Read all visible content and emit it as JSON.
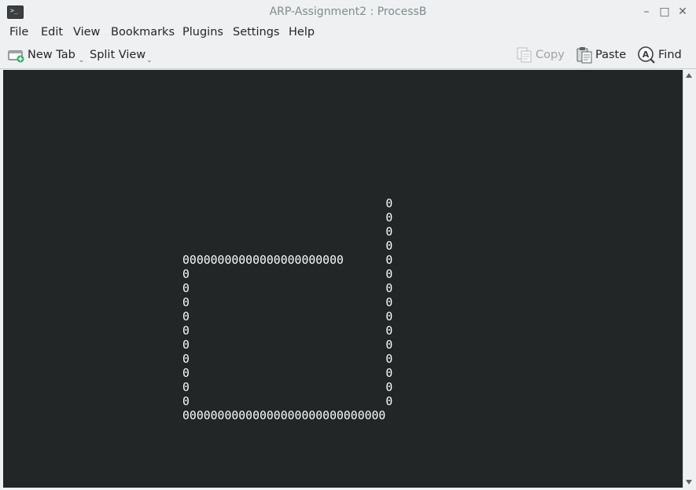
{
  "window": {
    "title": "ARP-Assignment2 : ProcessB",
    "icon": "terminal-icon",
    "icon_glyph": ">_",
    "controls": {
      "minimize": "–",
      "maximize": "□",
      "close": "✕"
    }
  },
  "menu": {
    "items": [
      "File",
      "Edit",
      "View",
      "Bookmarks",
      "Plugins",
      "Settings",
      "Help"
    ]
  },
  "toolbar": {
    "new_tab_label": "New Tab",
    "split_view_label": "Split View",
    "copy_label": "Copy",
    "paste_label": "Paste",
    "find_label": "Find",
    "dropdown_glyph": "⌄"
  },
  "terminal": {
    "lines": [
      "                             0",
      "                             0",
      "                             0",
      "                             0",
      "00000000000000000000000      0",
      "0                            0",
      "0                            0",
      "0                            0",
      "0                            0",
      "0                            0",
      "0                            0",
      "0                            0",
      "0                            0",
      "0                            0",
      "0                            0",
      "00000000000000000000000000000"
    ],
    "background": "#232627",
    "foreground": "#fcfcfc"
  }
}
